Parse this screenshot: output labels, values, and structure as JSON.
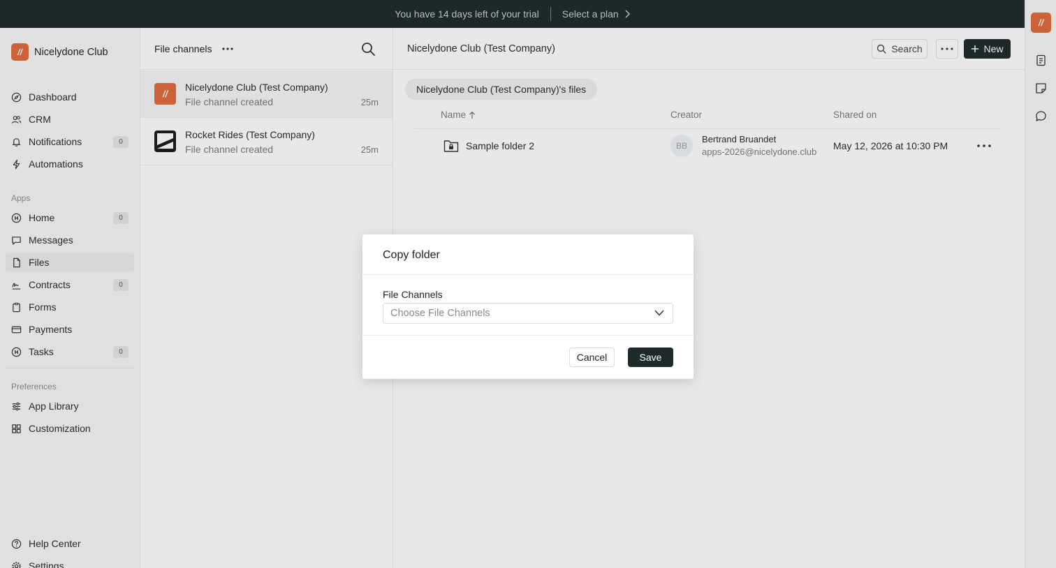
{
  "trial_bar": {
    "message": "You have 14 days left of your trial",
    "cta": "Select a plan"
  },
  "sidebar": {
    "brand": "Nicelydone Club",
    "nav": [
      {
        "label": "Dashboard"
      },
      {
        "label": "CRM"
      },
      {
        "label": "Notifications",
        "badge": "0"
      },
      {
        "label": "Automations"
      }
    ],
    "apps_label": "Apps",
    "apps": [
      {
        "label": "Home",
        "badge": "0"
      },
      {
        "label": "Messages"
      },
      {
        "label": "Files"
      },
      {
        "label": "Contracts",
        "badge": "0"
      },
      {
        "label": "Forms"
      },
      {
        "label": "Payments"
      },
      {
        "label": "Tasks",
        "badge": "0"
      }
    ],
    "preferences_label": "Preferences",
    "preferences": [
      {
        "label": "App Library"
      },
      {
        "label": "Customization"
      }
    ],
    "footer": [
      {
        "label": "Help Center"
      },
      {
        "label": "Settings"
      }
    ]
  },
  "channels": {
    "title": "File channels",
    "items": [
      {
        "title": "Nicelydone Club (Test Company)",
        "subtitle": "File channel created",
        "time": "25m"
      },
      {
        "title": "Rocket Rides (Test Company)",
        "subtitle": "File channel created",
        "time": "25m"
      }
    ]
  },
  "main": {
    "title": "Nicelydone Club (Test Company)",
    "search_label": "Search",
    "new_label": "New",
    "files_pill": "Nicelydone Club (Test Company)'s files",
    "columns": {
      "name": "Name",
      "creator": "Creator",
      "shared_on": "Shared on"
    },
    "rows": [
      {
        "name": "Sample folder 2",
        "creator_initials": "BB",
        "creator_name": "Bertrand Bruandet",
        "creator_email": "apps-2026@nicelydone.club",
        "shared_on": "May 12, 2026 at 10:30 PM"
      }
    ]
  },
  "modal": {
    "title": "Copy folder",
    "field_label": "File Channels",
    "select_placeholder": "Choose File Channels",
    "cancel_label": "Cancel",
    "save_label": "Save"
  },
  "colors": {
    "accent": "#e06a3c",
    "dark": "#1f2a2b"
  }
}
